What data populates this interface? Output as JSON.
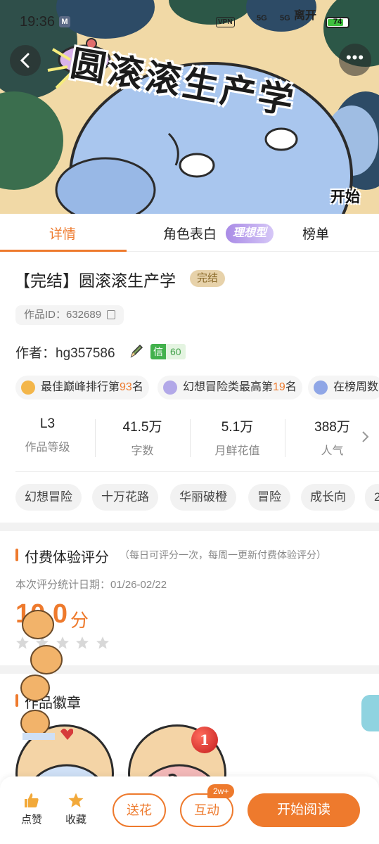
{
  "status_bar": {
    "time": "19:36",
    "vpn": "VPN",
    "signal_1": "5G",
    "signal_2": "5G",
    "carrier_text": "离开",
    "battery": "74",
    "battery_level": 0.74
  },
  "cover": {
    "title_art": "圆滚滚生产学",
    "start_label": "开始"
  },
  "tabs": [
    {
      "label": "详情",
      "active": true
    },
    {
      "label": "角色表白",
      "active": false
    },
    {
      "label": "榜单",
      "active": false
    }
  ],
  "tab_badge": "理想型",
  "book": {
    "title": "【完结】圆滚滚生产学",
    "status": "完结",
    "work_id": "作品ID：632689",
    "author_label": "作者：",
    "author": "hg357586",
    "credit_key": "信",
    "credit_value": "60"
  },
  "achievements": [
    {
      "pre": "最佳巅峰排行第",
      "num": "93",
      "post": "名"
    },
    {
      "pre": "幻想冒险类最高第",
      "num": "19",
      "post": "名"
    },
    {
      "pre": "在榜周数",
      "num": "",
      "post": ""
    }
  ],
  "stats": [
    {
      "value": "L3",
      "label": "作品等级"
    },
    {
      "value": "41.5万",
      "label": "字数"
    },
    {
      "value": "5.1万",
      "label": "月鲜花值"
    },
    {
      "value": "388万",
      "label": "人气"
    }
  ],
  "tags": [
    "幻想冒险",
    "十万花路",
    "华丽破橙",
    "冒险",
    "成长向",
    "2"
  ],
  "rating": {
    "title": "付费体验评分",
    "note": "（每日可评分一次，每周一更新付费体验评分）",
    "date": "本次评分统计日期：01/26-02/22",
    "score": "10.0",
    "unit": "分",
    "stars": 5
  },
  "badges": {
    "title": "作品徽章",
    "count": "1"
  },
  "bottom_bar": {
    "like": "点赞",
    "collect": "收藏",
    "flower": "送花",
    "interact": "互动",
    "interact_badge": "2w+",
    "read": "开始阅读"
  },
  "colors": {
    "accent": "#ee7a2d",
    "credit_green": "#42b14c",
    "status_tag_bg": "#e7d2aa"
  }
}
